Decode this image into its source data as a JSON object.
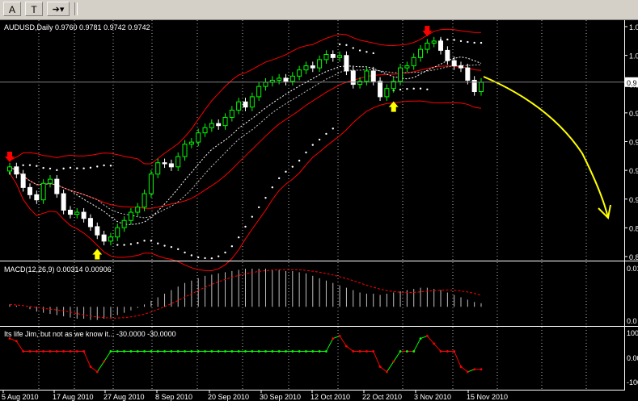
{
  "toolbar": {
    "btn_text": "A",
    "btn_label": "T",
    "btn_arrows": "➔▾"
  },
  "main": {
    "title": "AUDUSD,Daily  0.9760 0.9781 0.9742 0.9742",
    "price_ticks": [
      "1.0",
      "1.0",
      "0.9",
      "0.9",
      "0.9",
      "0.9",
      "0.9",
      "0.8",
      "0.8"
    ],
    "current_price": "0.9"
  },
  "macd": {
    "title": "MACD(12,26,9) 0.00314 0.00906",
    "ticks": [
      "0.01",
      "0.0"
    ]
  },
  "osc": {
    "title": "Its life Jim, but not as we know it...  -30.0000 -30.0000",
    "ticks": [
      "100",
      "0.00",
      "-100"
    ]
  },
  "x_labels": [
    "5 Aug 2010",
    "17 Aug 2010",
    "27 Aug 2010",
    "8 Sep 2010",
    "20 Sep 2010",
    "30 Sep 2010",
    "12 Oct 2010",
    "22 Oct 2010",
    "3 Nov 2010",
    "15 Nov 2010"
  ],
  "colors": {
    "bull": "#00ff00",
    "bear": "#ffffff",
    "band": "#ff0000",
    "arrow_buy": "#ffff00",
    "arrow_sell": "#ff0000",
    "osc_up": "#00ff00",
    "osc_down": "#ff0000"
  },
  "chart_data": {
    "type": "candlestick",
    "title": "AUDUSD,Daily  0.9760 0.9781 0.9742 0.9742",
    "ohlc_last": {
      "open": 0.976,
      "high": 0.9781,
      "low": 0.9742,
      "close": 0.9742
    },
    "closes": [
      0.892,
      0.885,
      0.872,
      0.865,
      0.86,
      0.876,
      0.88,
      0.866,
      0.85,
      0.846,
      0.848,
      0.842,
      0.834,
      0.826,
      0.82,
      0.824,
      0.833,
      0.84,
      0.848,
      0.853,
      0.866,
      0.885,
      0.896,
      0.895,
      0.892,
      0.902,
      0.914,
      0.916,
      0.925,
      0.93,
      0.934,
      0.932,
      0.94,
      0.947,
      0.955,
      0.95,
      0.96,
      0.97,
      0.974,
      0.976,
      0.978,
      0.975,
      0.98,
      0.986,
      0.99,
      0.988,
      0.996,
      1.001,
      0.998,
      1.0,
      0.985,
      0.972,
      0.975,
      0.985,
      0.975,
      0.96,
      0.968,
      0.975,
      0.988,
      0.99,
      0.998,
      1.006,
      1.012,
      1.014,
      1.005,
      0.995,
      0.99,
      0.988,
      0.976,
      0.965,
      0.974
    ],
    "macd": {
      "histogram": [
        0.002,
        0.001,
        0.0,
        -0.002,
        -0.004,
        -0.005,
        -0.006,
        -0.007,
        -0.008,
        -0.009,
        -0.01,
        -0.01,
        -0.011,
        -0.011,
        -0.01,
        -0.009,
        -0.007,
        -0.005,
        -0.003,
        -0.001,
        0.002,
        0.005,
        0.008,
        0.011,
        0.014,
        0.017,
        0.02,
        0.022,
        0.024,
        0.026,
        0.027,
        0.028,
        0.029,
        0.03,
        0.031,
        0.032,
        0.032,
        0.032,
        0.032,
        0.031,
        0.031,
        0.03,
        0.03,
        0.029,
        0.028,
        0.026,
        0.024,
        0.022,
        0.02,
        0.018,
        0.016,
        0.014,
        0.012,
        0.011,
        0.011,
        0.01,
        0.011,
        0.012,
        0.013,
        0.014,
        0.015,
        0.016,
        0.016,
        0.015,
        0.014,
        0.012,
        0.01,
        0.008,
        0.006,
        0.004,
        0.003
      ]
    },
    "oscillator": {
      "values": [
        90,
        80,
        40,
        40,
        40,
        40,
        40,
        40,
        40,
        40,
        40,
        40,
        -20,
        -40,
        0,
        40,
        40,
        40,
        40,
        40,
        40,
        40,
        40,
        40,
        40,
        40,
        40,
        40,
        40,
        40,
        40,
        40,
        40,
        40,
        40,
        40,
        40,
        40,
        40,
        40,
        40,
        40,
        40,
        40,
        40,
        40,
        40,
        40,
        90,
        100,
        60,
        40,
        40,
        40,
        40,
        -20,
        -40,
        0,
        40,
        40,
        40,
        90,
        100,
        70,
        40,
        40,
        40,
        -20,
        -40,
        -30,
        -30
      ]
    }
  }
}
